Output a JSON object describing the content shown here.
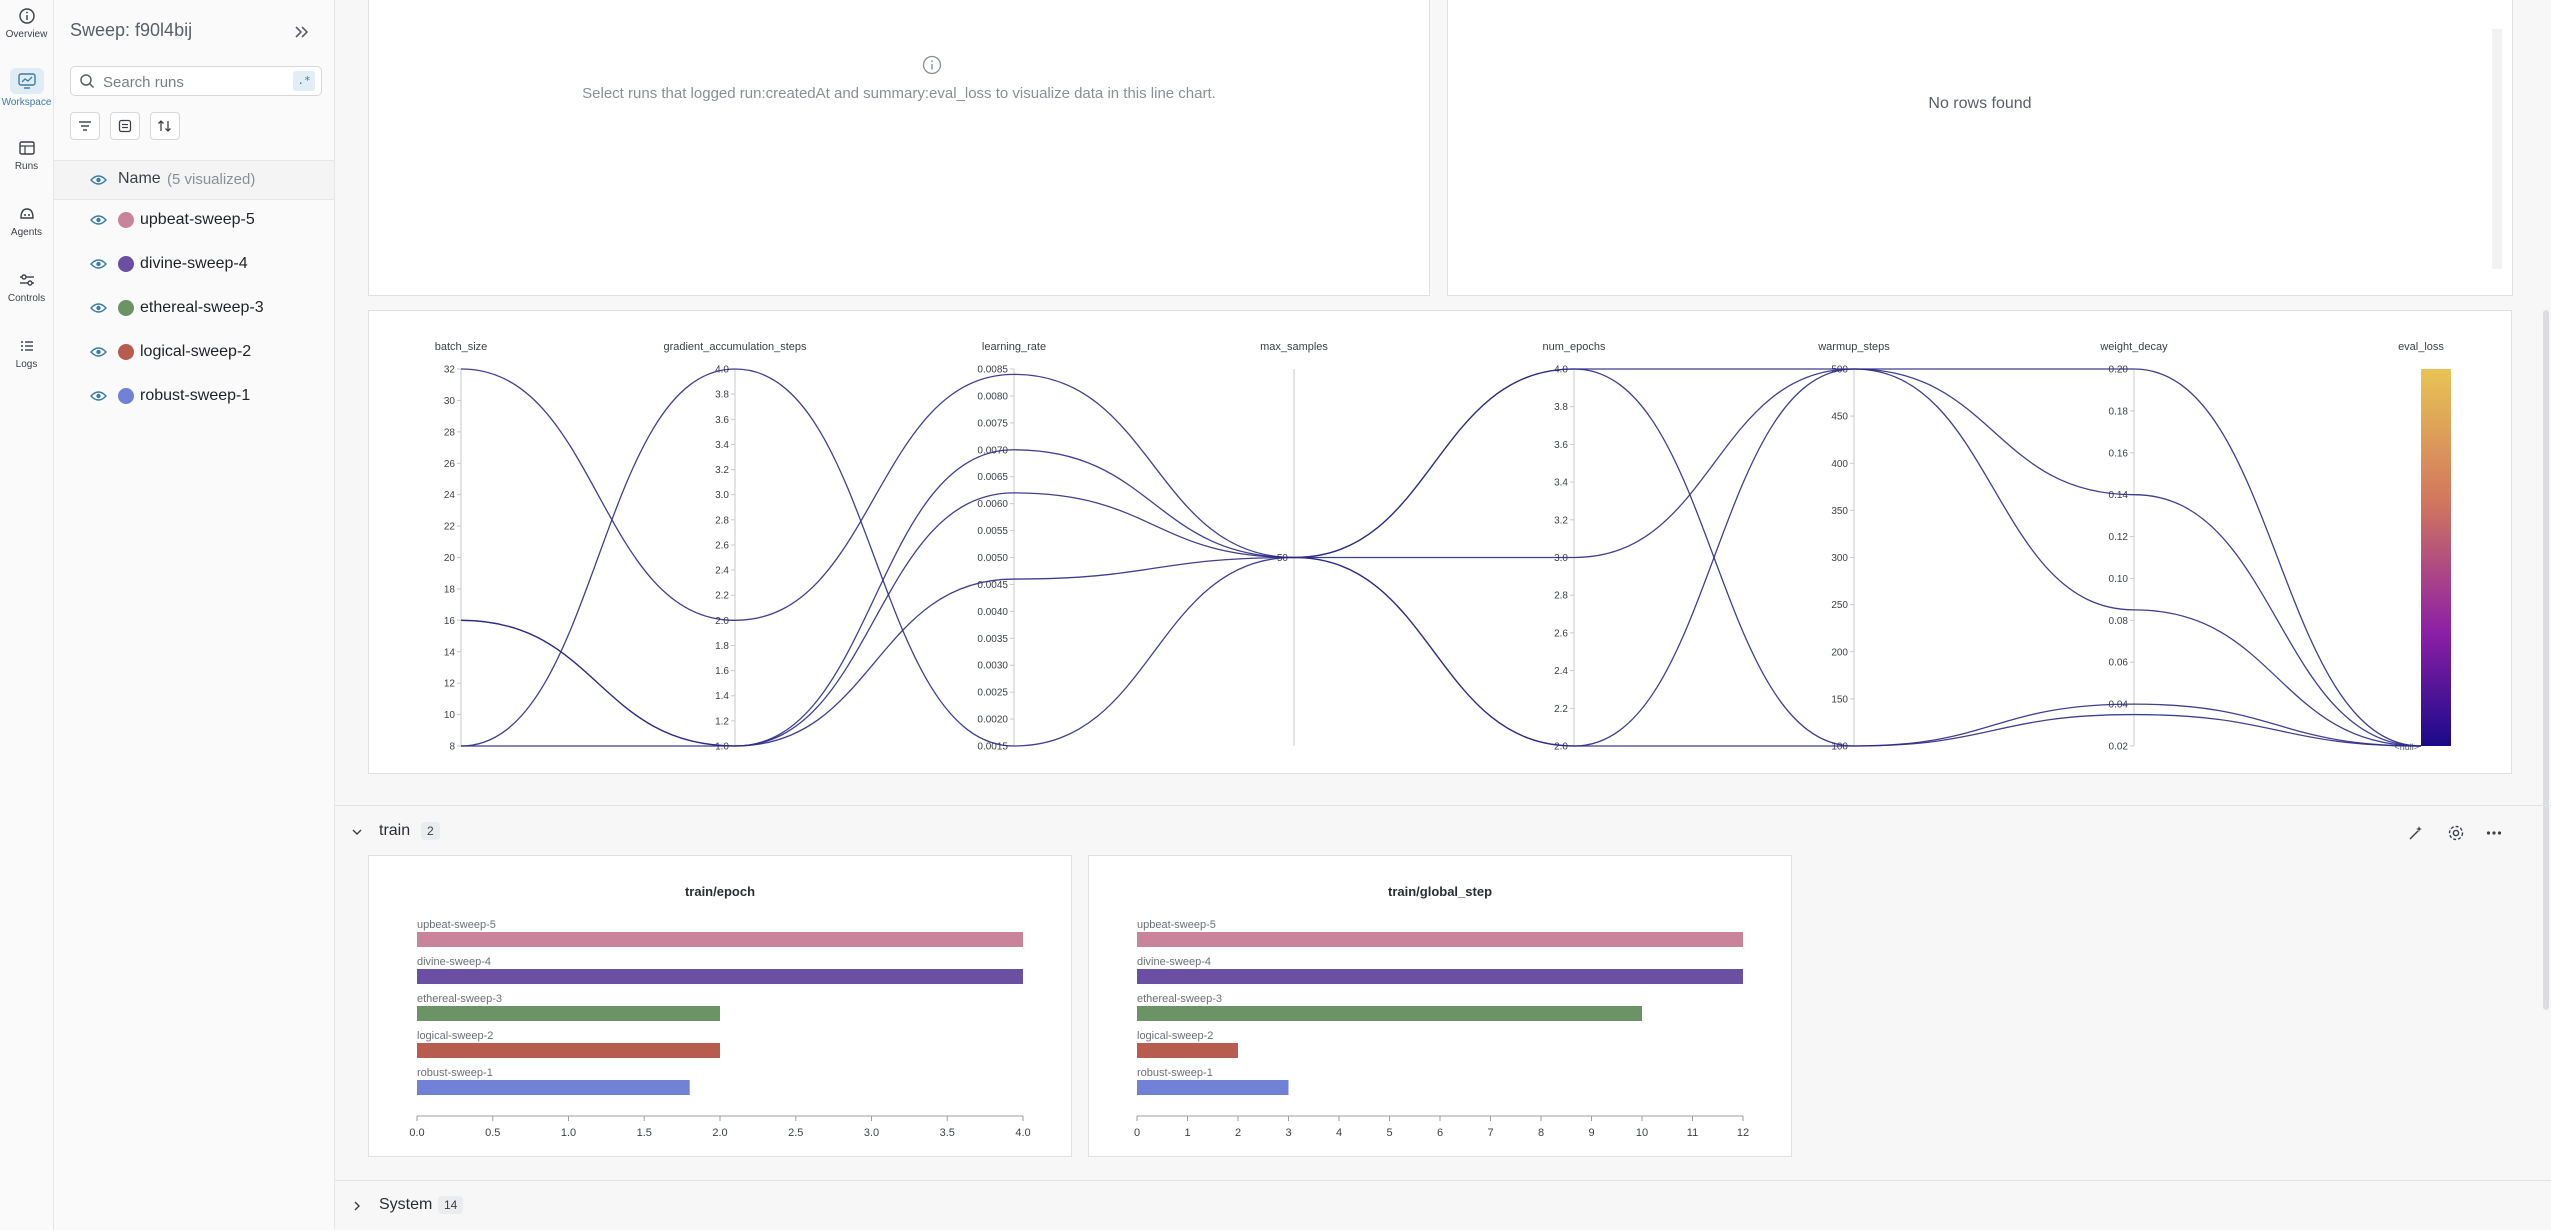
{
  "nav": [
    {
      "label": "Overview",
      "icon": "info-circle-icon"
    },
    {
      "label": "Workspace",
      "icon": "workspace-icon",
      "active": true
    },
    {
      "label": "Runs",
      "icon": "table-icon"
    },
    {
      "label": "Agents",
      "icon": "agent-icon"
    },
    {
      "label": "Controls",
      "icon": "sliders-icon"
    },
    {
      "label": "Logs",
      "icon": "list-icon"
    }
  ],
  "sidebar": {
    "title": "Sweep: f90l4bij",
    "search_placeholder": "Search runs",
    "regex_label": ".*",
    "name_header": "Name",
    "visualized_note": "(5 visualized)",
    "runs": [
      {
        "name": "upbeat-sweep-5",
        "color": "#c9839a"
      },
      {
        "name": "divine-sweep-4",
        "color": "#6a4fa3"
      },
      {
        "name": "ethereal-sweep-3",
        "color": "#6b9365"
      },
      {
        "name": "logical-sweep-2",
        "color": "#b85c4f"
      },
      {
        "name": "robust-sweep-1",
        "color": "#7081d6"
      }
    ]
  },
  "panels": {
    "line_chart_message": "Select runs that logged run:createdAt and summary:eval_loss to visualize data in this line chart.",
    "table_empty": "No rows found"
  },
  "sections": {
    "train": {
      "title": "train",
      "count": "2"
    },
    "system": {
      "title": "System",
      "count": "14"
    }
  },
  "parcoords": {
    "line_color": "#2b2a86",
    "axes": [
      {
        "name": "batch_size",
        "ticks": [
          "32",
          "30",
          "28",
          "26",
          "24",
          "22",
          "20",
          "18",
          "16",
          "14",
          "12",
          "10",
          "8"
        ]
      },
      {
        "name": "gradient_accumulation_steps",
        "ticks": [
          "4.0",
          "3.8",
          "3.6",
          "3.4",
          "3.2",
          "3.0",
          "2.8",
          "2.6",
          "2.4",
          "2.2",
          "2.0",
          "1.8",
          "1.6",
          "1.4",
          "1.2",
          "1.0"
        ]
      },
      {
        "name": "learning_rate",
        "ticks": [
          "0.0085",
          "0.0080",
          "0.0075",
          "0.0070",
          "0.0065",
          "0.0060",
          "0.0055",
          "0.0050",
          "0.0045",
          "0.0040",
          "0.0035",
          "0.0030",
          "0.0025",
          "0.0020",
          "0.0015"
        ]
      },
      {
        "name": "max_samples",
        "ticks": [
          "50"
        ]
      },
      {
        "name": "num_epochs",
        "ticks": [
          "4.0",
          "3.8",
          "3.6",
          "3.4",
          "3.2",
          "3.0",
          "2.8",
          "2.6",
          "2.4",
          "2.2",
          "2.0"
        ]
      },
      {
        "name": "warmup_steps",
        "ticks": [
          "500",
          "450",
          "400",
          "350",
          "300",
          "250",
          "200",
          "150",
          "100"
        ]
      },
      {
        "name": "weight_decay",
        "ticks": [
          "0.20",
          "0.18",
          "0.16",
          "0.14",
          "0.12",
          "0.10",
          "0.08",
          "0.06",
          "0.04",
          "0.02"
        ]
      },
      {
        "name": "eval_loss",
        "ticks": [
          "<null>"
        ]
      }
    ],
    "runs": [
      {
        "batch_size": 8,
        "gradient_accumulation_steps": 4.0,
        "learning_rate": 0.0015,
        "max_samples": 50,
        "num_epochs": 4.0,
        "warmup_steps": 500,
        "weight_decay": 0.2
      },
      {
        "batch_size": 32,
        "gradient_accumulation_steps": 2.0,
        "learning_rate": 0.0084,
        "max_samples": 50,
        "num_epochs": 2.0,
        "warmup_steps": 100,
        "weight_decay": 0.035
      },
      {
        "batch_size": 16,
        "gradient_accumulation_steps": 1.0,
        "learning_rate": 0.007,
        "max_samples": 50,
        "num_epochs": 3.0,
        "warmup_steps": 500,
        "weight_decay": 0.14
      },
      {
        "batch_size": 16,
        "gradient_accumulation_steps": 1.0,
        "learning_rate": 0.0062,
        "max_samples": 50,
        "num_epochs": 2.0,
        "warmup_steps": 500,
        "weight_decay": 0.085
      },
      {
        "batch_size": 8,
        "gradient_accumulation_steps": 1.0,
        "learning_rate": 0.0046,
        "max_samples": 50,
        "num_epochs": 4.0,
        "warmup_steps": 100,
        "weight_decay": 0.04
      }
    ]
  },
  "chart_data": [
    {
      "type": "bar",
      "title": "train/epoch",
      "categories": [
        "upbeat-sweep-5",
        "divine-sweep-4",
        "ethereal-sweep-3",
        "logical-sweep-2",
        "robust-sweep-1"
      ],
      "values": [
        4.0,
        4.0,
        2.0,
        2.0,
        1.8
      ],
      "colors": [
        "#c9839a",
        "#6a4fa3",
        "#6b9365",
        "#b85c4f",
        "#7081d6"
      ],
      "xlim": [
        0,
        4.0
      ],
      "xticks": [
        "0.0",
        "0.5",
        "1.0",
        "1.5",
        "2.0",
        "2.5",
        "3.0",
        "3.5",
        "4.0"
      ],
      "orientation": "horizontal"
    },
    {
      "type": "bar",
      "title": "train/global_step",
      "categories": [
        "upbeat-sweep-5",
        "divine-sweep-4",
        "ethereal-sweep-3",
        "logical-sweep-2",
        "robust-sweep-1"
      ],
      "values": [
        12,
        12,
        10,
        2,
        3
      ],
      "colors": [
        "#c9839a",
        "#6a4fa3",
        "#6b9365",
        "#b85c4f",
        "#7081d6"
      ],
      "xlim": [
        0,
        12
      ],
      "xticks": [
        "0",
        "1",
        "2",
        "3",
        "4",
        "5",
        "6",
        "7",
        "8",
        "9",
        "10",
        "11",
        "12"
      ],
      "orientation": "horizontal"
    }
  ]
}
